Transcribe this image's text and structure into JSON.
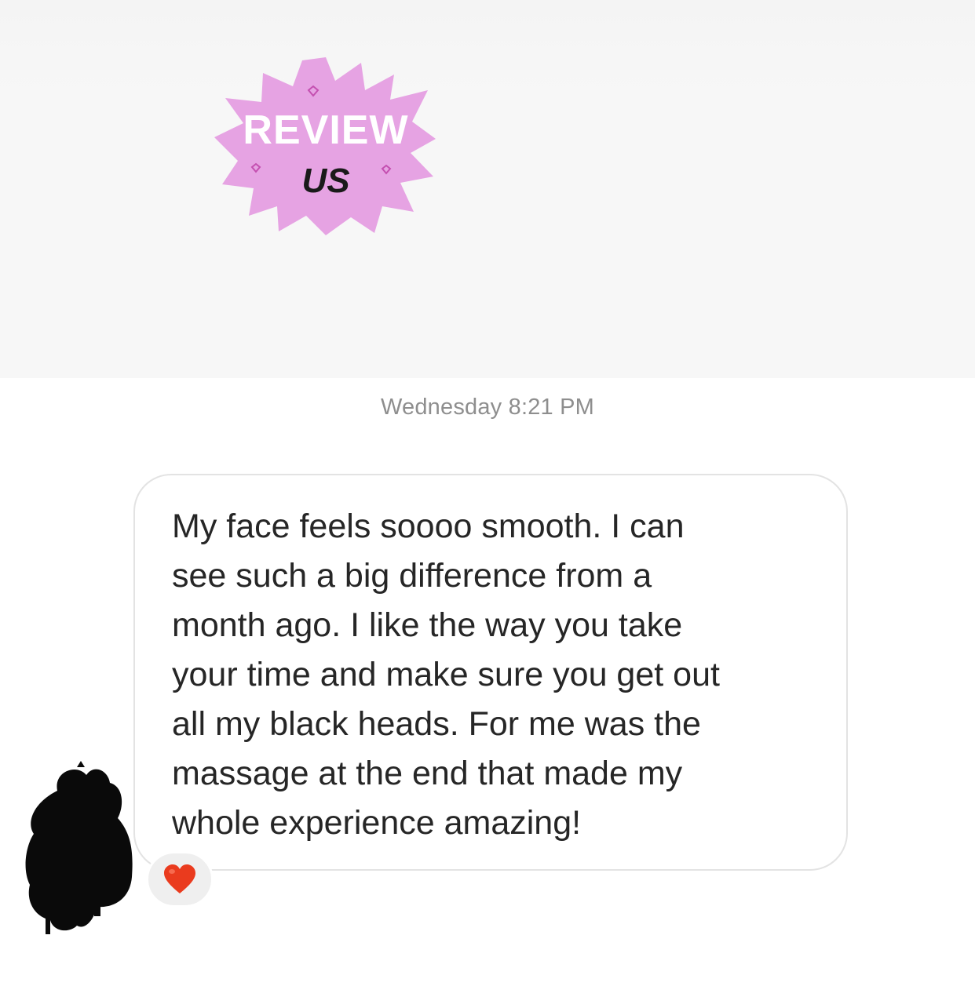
{
  "sticker": {
    "line1": "REVIEW",
    "line2": "US"
  },
  "conversation": {
    "timestamp": "Wednesday 8:21 PM",
    "message": {
      "text": "My face feels soooo smooth. I can\nsee such a big difference from a\nmonth ago. I like the way you take\nyour time and  make sure you get out\nall my black heads. For me was the\nmassage at the end that made my\nwhole experience amazing!",
      "reaction": "heart-emoji",
      "sender_avatar": "redacted-avatar"
    }
  },
  "colors": {
    "sticker_fill": "#e6a3e3",
    "reaction_heart": "#ea3b1e",
    "timestamp_text": "#8e8e8e",
    "message_text": "#262626"
  }
}
